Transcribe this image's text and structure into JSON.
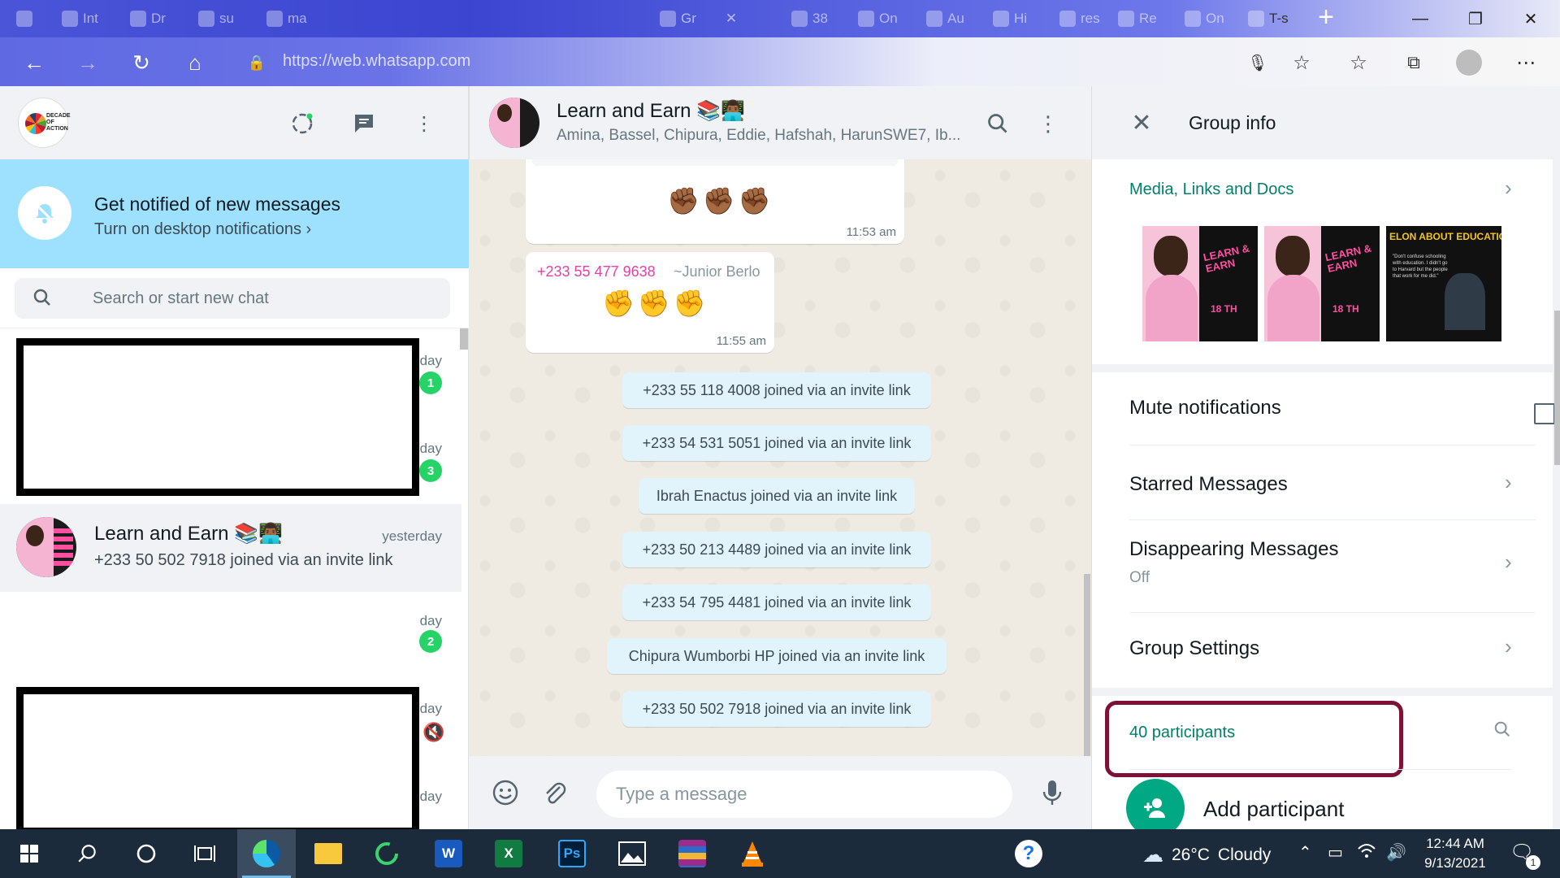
{
  "browser": {
    "tabs": [
      {
        "label": "Int"
      },
      {
        "label": "Dr"
      },
      {
        "label": "su"
      },
      {
        "label": "ma"
      },
      {
        "label": "Gr"
      },
      {
        "label": "38"
      },
      {
        "label": "On"
      },
      {
        "label": "Au"
      },
      {
        "label": "Hi"
      },
      {
        "label": "res"
      },
      {
        "label": "Re"
      },
      {
        "label": "On"
      },
      {
        "label": "T-s"
      }
    ],
    "new_tab": "+",
    "url": "https://web.whatsapp.com",
    "window_controls": {
      "minimize": "—",
      "maximize": "❐",
      "close": "✕"
    },
    "accent": "#4a55d8"
  },
  "sidebar": {
    "avatar_text": "DECADE OF ACTION",
    "notification": {
      "title": "Get notified of new messages",
      "subtitle": "Turn on desktop notifications ›"
    },
    "search_placeholder": "Search or start new chat",
    "chats": [
      {
        "time": "day",
        "badge": "1",
        "redacted": true
      },
      {
        "time": "day",
        "badge": "3",
        "redacted": true
      },
      {
        "name": "Learn and Earn 📚👨🏾‍💻",
        "time": "yesterday",
        "last": "+233 50 502 7918 joined via an invite link",
        "active": true
      },
      {
        "time": "day",
        "badge": "2",
        "redacted": true
      },
      {
        "time": "day",
        "muted": true,
        "redacted": true
      },
      {
        "time": "day",
        "redacted": true
      }
    ]
  },
  "conversation": {
    "title": "Learn and Earn 📚👨🏾‍💻",
    "members": "Amina, Bassel, Chipura, Eddie, Hafshah, HarunSWE7, Ib...",
    "messages": [
      {
        "emojis": "✊🏾✊🏾✊🏾",
        "time": "11:53 am"
      },
      {
        "sender": "+233 55 477 9638",
        "alias": "~Junior Berlo",
        "emojis": "✊✊✊",
        "time": "11:55 am"
      }
    ],
    "system": [
      "+233 55 118 4008 joined via an invite link",
      "+233 54 531 5051 joined via an invite link",
      "Ibrah Enactus joined via an invite link",
      "+233 50 213 4489 joined via an invite link",
      "+233 54 795 4481 joined via an invite link",
      "Chipura Wumborbi HP joined via an invite link",
      "+233 50 502 7918 joined via an invite link"
    ],
    "composer_placeholder": "Type a message",
    "wallpaper": "#efeae2",
    "system_bubble_color": "#e1f3fb",
    "sender_color": "#e542a3"
  },
  "group_info": {
    "title": "Group info",
    "media_label": "Media, Links and Docs",
    "media": [
      {
        "title": "LEARN & EARN",
        "date": "18 TH"
      },
      {
        "title": "LEARN & EARN",
        "date": "18 TH"
      },
      {
        "title": "ELON ABOUT EDUCATION",
        "quote": "\"Don't confuse schooling with education. I didn't go to Harvard but the people that work for me did.\""
      }
    ],
    "mute_label": "Mute notifications",
    "mute_checked": false,
    "starred_label": "Starred Messages",
    "disappearing_label": "Disappearing Messages",
    "disappearing_value": "Off",
    "group_settings_label": "Group Settings",
    "participants_label": "40 participants",
    "add_participant_label": "Add participant",
    "accent": "#008069",
    "highlight_color": "#7d1136"
  },
  "taskbar": {
    "weather": {
      "temp": "26°C",
      "condition": "Cloudy"
    },
    "time": "12:44 AM",
    "date": "9/13/2021",
    "notification_count": "1"
  }
}
